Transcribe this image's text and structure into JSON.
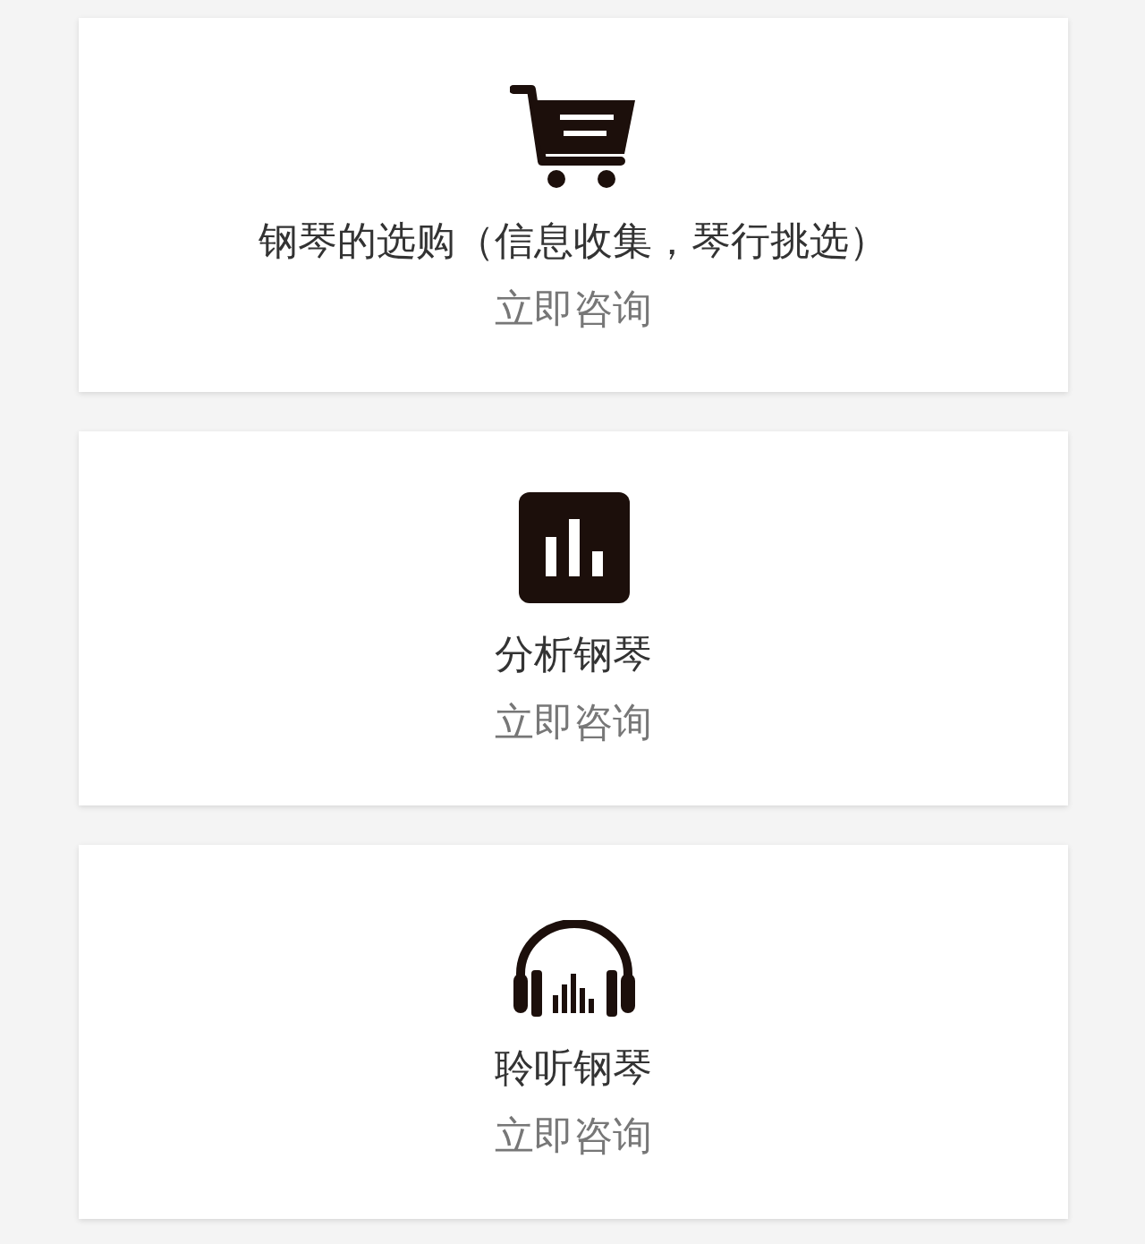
{
  "cards": [
    {
      "kind": "cart",
      "title": "钢琴的选购（信息收集，琴行挑选）",
      "action": "立即咨询"
    },
    {
      "kind": "chart",
      "title": "分析钢琴",
      "action": "立即咨询"
    },
    {
      "kind": "headphones",
      "title": "聆听钢琴",
      "action": "立即咨询"
    }
  ]
}
